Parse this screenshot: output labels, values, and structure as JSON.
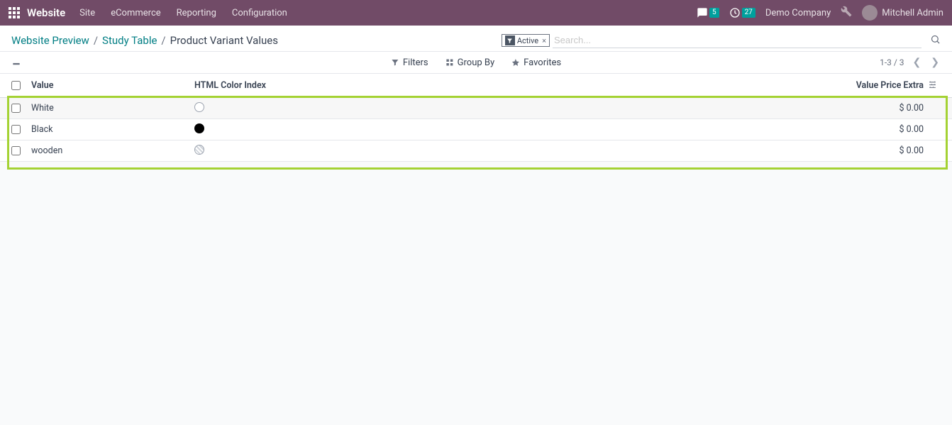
{
  "topbar": {
    "brand": "Website",
    "nav": [
      "Site",
      "eCommerce",
      "Reporting",
      "Configuration"
    ],
    "chat_count": "5",
    "clock_count": "27",
    "company": "Demo Company",
    "user": "Mitchell Admin"
  },
  "breadcrumbs": {
    "items": [
      "Website Preview",
      "Study Table",
      "Product Variant Values"
    ]
  },
  "search": {
    "chip_label": "Active",
    "placeholder": "Search..."
  },
  "toolbar": {
    "filters": "Filters",
    "groupby": "Group By",
    "favorites": "Favorites",
    "pager": "1-3 / 3"
  },
  "columns": {
    "value": "Value",
    "color": "HTML Color Index",
    "price": "Value Price Extra"
  },
  "rows": [
    {
      "value": "White",
      "swatch": "swatch-white",
      "price": "$ 0.00"
    },
    {
      "value": "Black",
      "swatch": "swatch-black",
      "price": "$ 0.00"
    },
    {
      "value": "wooden",
      "swatch": "swatch-none",
      "price": "$ 0.00"
    }
  ]
}
